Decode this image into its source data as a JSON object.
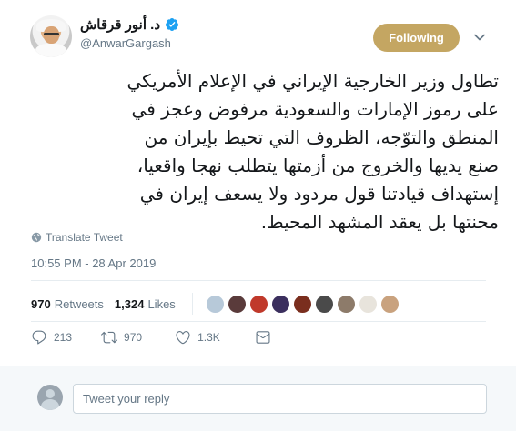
{
  "author": {
    "display_name": "د. أنور قرقاش",
    "handle": "@AnwarGargash",
    "verified": true
  },
  "follow_button": {
    "label": "Following",
    "color": "#c4a662"
  },
  "tweet": {
    "lines": [
      "تطاول وزير الخارجية الإيراني في الإعلام الأمريكي",
      "على رموز الإمارات والسعودية مرفوض وعجز في",
      "المنطق والتوّجه، الظروف التي تحيط بإيران من",
      "صنع يديها والخروج من أزمتها يتطلب نهجا واقعيا،",
      "إستهداف قيادتنا قول مردود ولا يسعف إيران في",
      "محنتها بل يعقد المشهد المحيط."
    ],
    "translate_label": "Translate Tweet",
    "timestamp": "10:55 PM - 28 Apr 2019"
  },
  "stats": {
    "retweets": {
      "count": "970",
      "label": "Retweets"
    },
    "likes": {
      "count": "1,324",
      "label": "Likes"
    },
    "liker_avatar_colors": [
      "#b7c9d9",
      "#5a3b3b",
      "#c0392b",
      "#3b2f5e",
      "#7a2e1e",
      "#4a4a4a",
      "#8d7b6a",
      "#e8e4dc",
      "#c9a27e"
    ]
  },
  "actions": {
    "reply_count": "213",
    "retweet_count": "970",
    "like_count": "1.3K"
  },
  "reply_box": {
    "placeholder": "Tweet your reply"
  },
  "colors": {
    "accent": "#1da1f2",
    "muted": "#657786",
    "text": "#14171a",
    "border": "#e6ecf0"
  }
}
